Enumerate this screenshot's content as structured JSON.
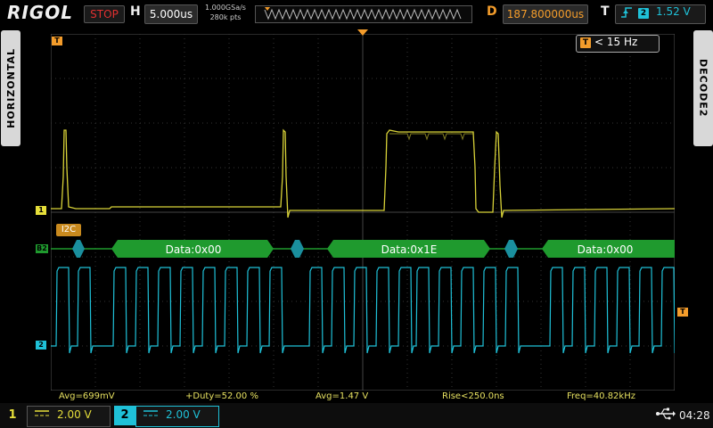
{
  "header": {
    "brand": "RIGOL",
    "run_status": "STOP",
    "horizontal_label": "H",
    "timebase": "5.000us",
    "sample_rate": "1.000GSa/s",
    "memory_depth": "280k pts",
    "delay_label": "D",
    "delay_value": "187.800000us",
    "trigger_label": "T",
    "trigger_source": "2",
    "trigger_level": "1.52 V"
  },
  "side": {
    "left_tab": "HORIZONTAL",
    "right_tab": "DECODE2"
  },
  "freq_counter": {
    "icon": "T",
    "text": "< 15 Hz"
  },
  "decode": {
    "protocol_tag": "I2C",
    "channel_marker": "B2",
    "packets": [
      "Data:0x00",
      "Data:0x1E",
      "Data:0x00"
    ]
  },
  "markers": {
    "ch1": "1",
    "ch2": "2",
    "trigger": "T"
  },
  "measurements": {
    "ch1_avg": "Avg=699mV",
    "duty": "+Duty=52.00 %",
    "ch2_avg": "Avg=1.47 V",
    "rise": "Rise<250.0ns",
    "freq": "Freq=40.82kHz"
  },
  "channels": [
    {
      "id": "1",
      "coupling": "DC",
      "scale": "2.00 V",
      "color": "#e6df3a"
    },
    {
      "id": "2",
      "coupling": "DC",
      "scale": "2.00 V",
      "color": "#1fc1d8"
    }
  ],
  "status_bar": {
    "usb_icon": "usb-icon",
    "clock": "04:28"
  },
  "colors": {
    "ch1": "#e6df3a",
    "ch2": "#1fc1d8",
    "decode_bus": "#1f9a2e",
    "accent": "#f39c2b"
  }
}
